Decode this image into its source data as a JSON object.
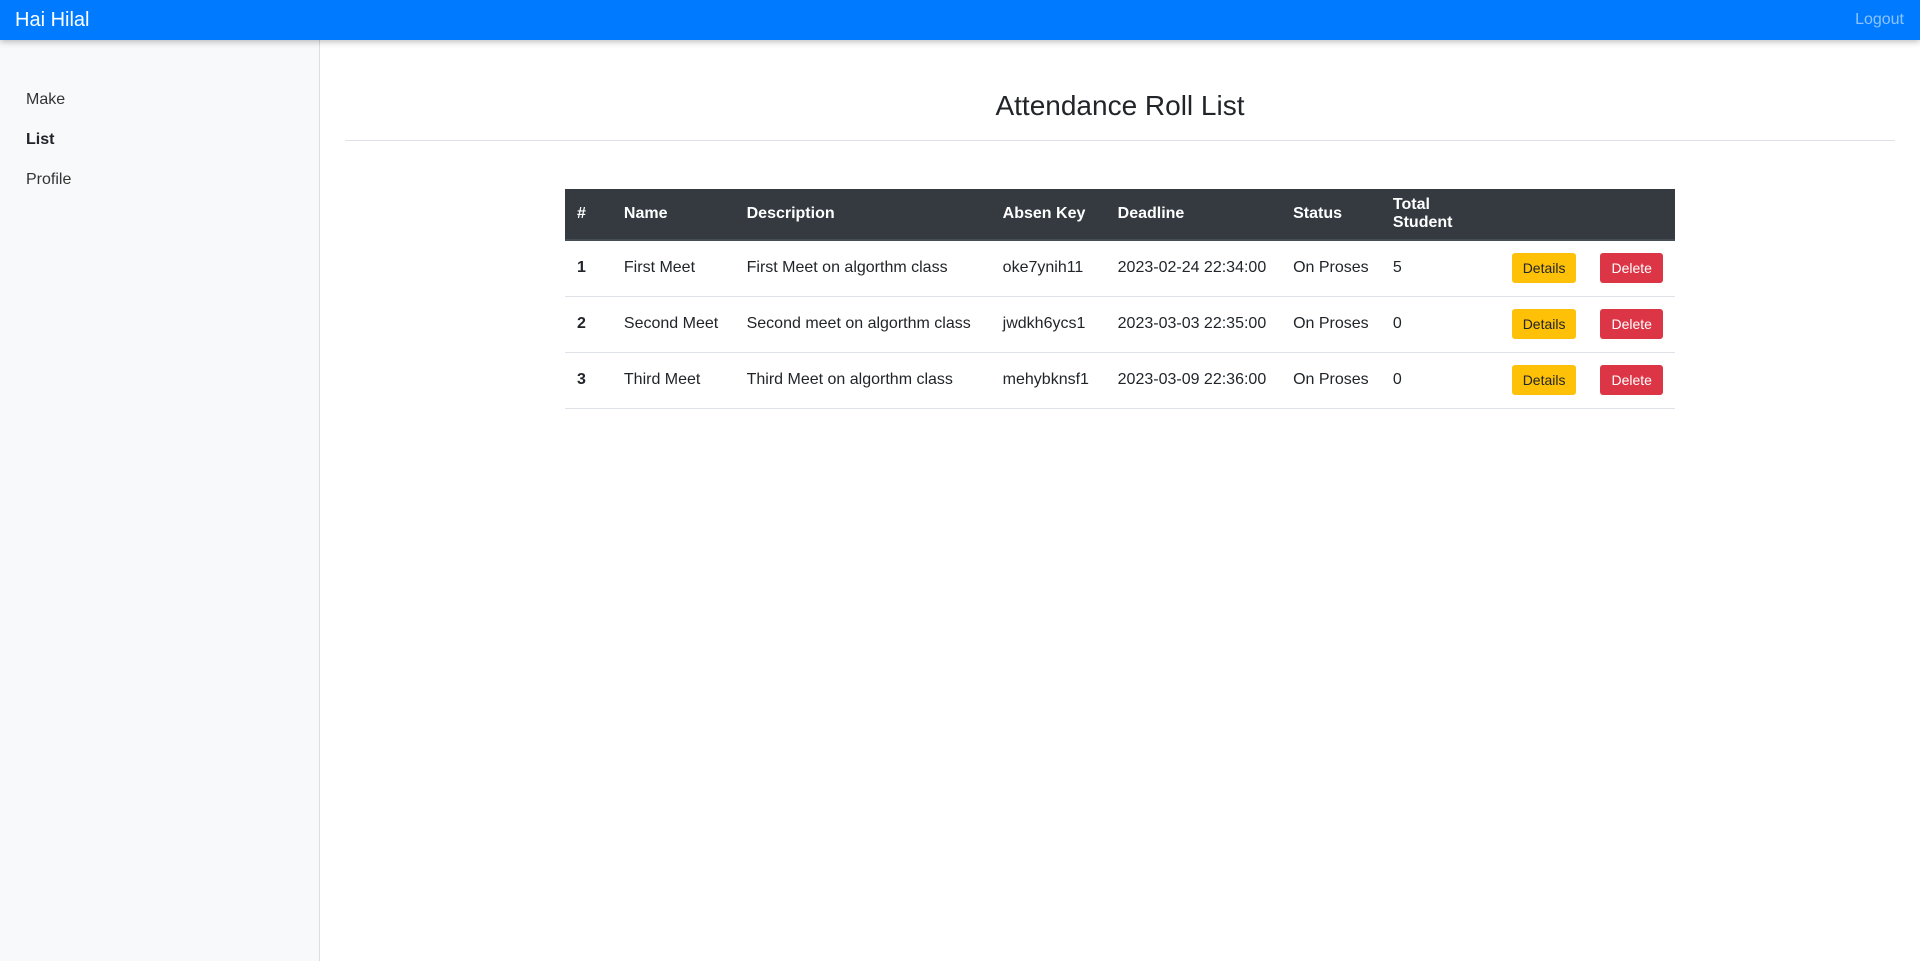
{
  "navbar": {
    "brand": "Hai Hilal",
    "logout": "Logout"
  },
  "sidebar": {
    "items": [
      {
        "label": "Make",
        "active": false
      },
      {
        "label": "List",
        "active": true
      },
      {
        "label": "Profile",
        "active": false
      }
    ]
  },
  "page": {
    "title": "Attendance Roll List"
  },
  "table": {
    "headers": [
      "#",
      "Name",
      "Description",
      "Absen Key",
      "Deadline",
      "Status",
      "Total Student",
      "",
      ""
    ],
    "rows": [
      {
        "num": "1",
        "name": "First Meet",
        "description": "First Meet on algorthm class",
        "key": "oke7ynih11",
        "deadline": "2023-02-24 22:34:00",
        "status": "On Proses",
        "total": "5",
        "details": "Details",
        "delete": "Delete"
      },
      {
        "num": "2",
        "name": "Second Meet",
        "description": "Second meet on algorthm class",
        "key": "jwdkh6ycs1",
        "deadline": "2023-03-03 22:35:00",
        "status": "On Proses",
        "total": "0",
        "details": "Details",
        "delete": "Delete"
      },
      {
        "num": "3",
        "name": "Third Meet",
        "description": "Third Meet on algorthm class",
        "key": "mehybknsf1",
        "deadline": "2023-03-09 22:36:00",
        "status": "On Proses",
        "total": "0",
        "details": "Details",
        "delete": "Delete"
      }
    ]
  },
  "colors": {
    "navbar": "#007bff",
    "table_header": "#343a40",
    "details_button": "#ffc107",
    "delete_button": "#dc3545"
  }
}
